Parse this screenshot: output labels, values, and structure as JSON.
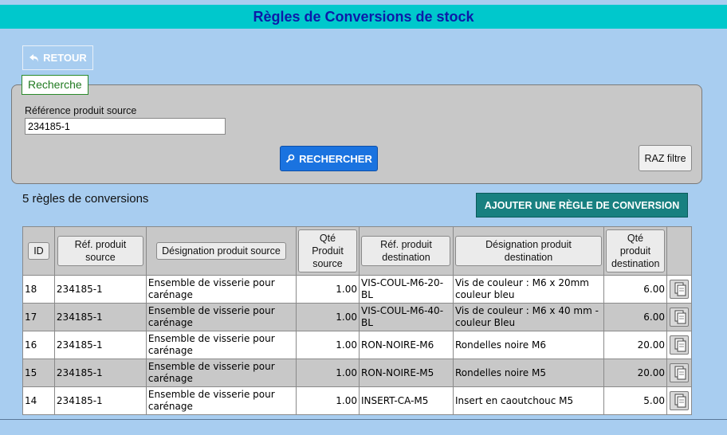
{
  "header": {
    "title": "Règles de Conversions de stock"
  },
  "nav": {
    "back_label": "RETOUR",
    "back_icon": "undo-arrow-icon"
  },
  "search": {
    "legend": "Recherche",
    "source_ref_label": "Référence produit source",
    "source_ref_value": "234185-1",
    "search_button": "RECHERCHER",
    "search_icon": "magnifier-icon",
    "reset_button": "RAZ filtre"
  },
  "results": {
    "count_text": "5 règles de conversions",
    "add_button": "AJOUTER UNE RÈGLE DE CONVERSION"
  },
  "table": {
    "headers": {
      "id": "ID",
      "src_ref": "Réf. produit source",
      "src_desig": "Désignation produit source",
      "src_qty": "Qté Produit source",
      "dst_ref": "Réf. produit destination",
      "dst_desig": "Désignation produit destination",
      "dst_qty": "Qté produit destination"
    },
    "rows": [
      {
        "id": "18",
        "src_ref": "234185-1",
        "src_desig": "Ensemble de visserie pour carénage",
        "src_qty": "1.00",
        "dst_ref": "VIS-COUL-M6-20-BL",
        "dst_desig": "Vis de couleur : M6 x 20mm couleur bleu",
        "dst_qty": "6.00"
      },
      {
        "id": "17",
        "src_ref": "234185-1",
        "src_desig": "Ensemble de visserie pour carénage",
        "src_qty": "1.00",
        "dst_ref": "VIS-COUL-M6-40-BL",
        "dst_desig": "Vis de couleur : M6 x 40 mm - couleur Bleu",
        "dst_qty": "6.00"
      },
      {
        "id": "16",
        "src_ref": "234185-1",
        "src_desig": "Ensemble de visserie pour carénage",
        "src_qty": "1.00",
        "dst_ref": "RON-NOIRE-M6",
        "dst_desig": "Rondelles noire M6",
        "dst_qty": "20.00"
      },
      {
        "id": "15",
        "src_ref": "234185-1",
        "src_desig": "Ensemble de visserie pour carénage",
        "src_qty": "1.00",
        "dst_ref": "RON-NOIRE-M5",
        "dst_desig": "Rondelles noire M5",
        "dst_qty": "20.00"
      },
      {
        "id": "14",
        "src_ref": "234185-1",
        "src_desig": "Ensemble de visserie pour carénage",
        "src_qty": "1.00",
        "dst_ref": "INSERT-CA-M5",
        "dst_desig": "Insert en caoutchouc M5",
        "dst_qty": "5.00"
      }
    ]
  },
  "colors": {
    "background": "#a8cdf0",
    "title_bar": "#00c8cc",
    "title_text": "#0d1aa8",
    "search_button": "#1a73e0",
    "add_button": "#188080"
  }
}
